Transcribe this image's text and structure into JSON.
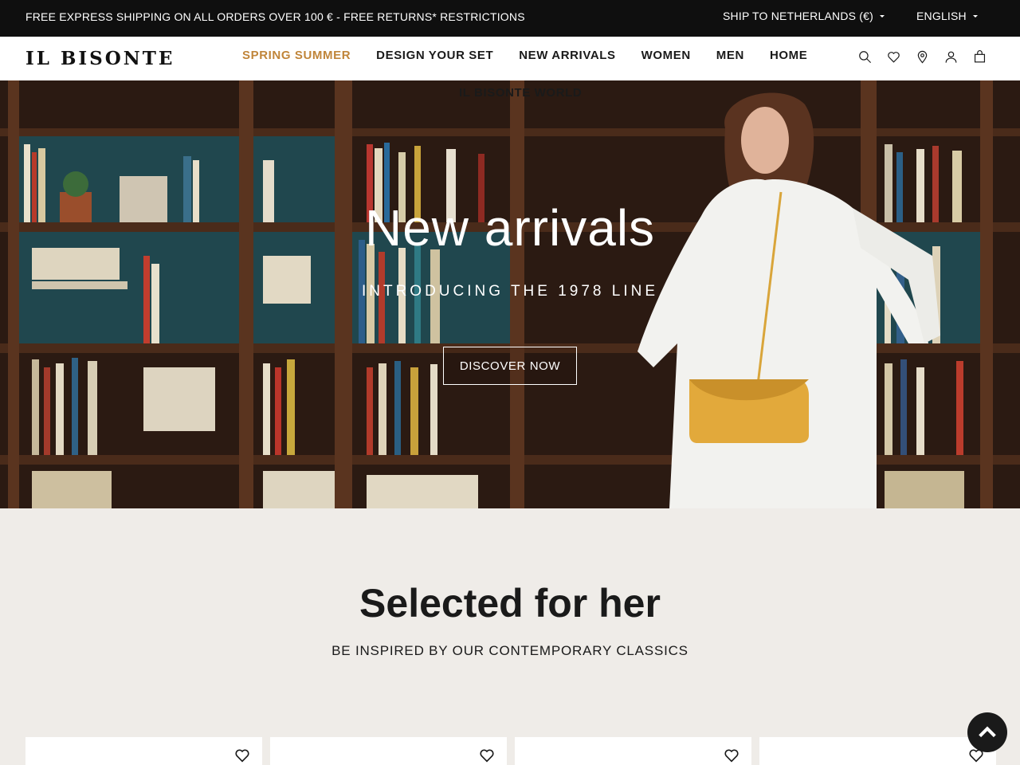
{
  "topbar": {
    "promo": "FREE EXPRESS SHIPPING ON ALL ORDERS OVER 100 € - FREE RETURNS* RESTRICTIONS",
    "ship_to": "SHIP TO NETHERLANDS (€)",
    "language": "ENGLISH"
  },
  "header": {
    "logo": "IL BISONTE",
    "nav": [
      "SPRING SUMMER",
      "DESIGN YOUR SET",
      "NEW ARRIVALS",
      "WOMEN",
      "MEN",
      "HOME"
    ],
    "nav_overflow": "IL BISONTE WORLD",
    "accent_color": "#c0853a",
    "icons": [
      "search-icon",
      "heart-icon",
      "location-pin-icon",
      "user-icon",
      "bag-icon"
    ]
  },
  "hero": {
    "title": "New arrivals",
    "subtitle": "INTRODUCING THE 1978 LINE",
    "cta": "DISCOVER NOW"
  },
  "section": {
    "title": "Selected for her",
    "subtitle": "BE INSPIRED BY OUR CONTEMPORARY CLASSICS"
  },
  "products": [
    {
      "name": "product-card-1",
      "wishlist_icon": "heart-icon"
    },
    {
      "name": "product-card-2",
      "wishlist_icon": "heart-icon"
    },
    {
      "name": "product-card-3",
      "wishlist_icon": "heart-icon"
    },
    {
      "name": "product-card-4",
      "wishlist_icon": "heart-icon"
    }
  ],
  "back_to_top_icon": "chevron-up-icon"
}
